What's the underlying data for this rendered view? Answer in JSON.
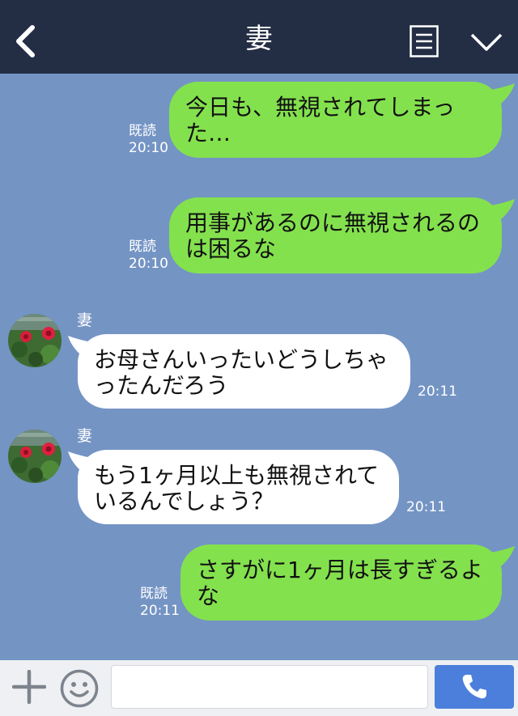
{
  "header": {
    "title": "妻",
    "icons": [
      "chevron-left-icon",
      "notes-icon",
      "chevron-down-icon"
    ],
    "background": "#232e45"
  },
  "chat": {
    "background": "#7494c4",
    "outgoing_bubble_color": "#84e14e",
    "incoming_bubble_color": "#ffffff",
    "messages": [
      {
        "direction": "out",
        "text": "今日も、無視されてしまった…",
        "read_label": "既読",
        "time": "20:10"
      },
      {
        "direction": "out",
        "text": "用事があるのに無視されるのは困るな",
        "read_label": "既読",
        "time": "20:10"
      },
      {
        "direction": "in",
        "sender": "妻",
        "text": "お母さんいったいどうしちゃったんだろう",
        "time": "20:11"
      },
      {
        "direction": "in",
        "sender": "妻",
        "text": "もう1ヶ月以上も無視されているんでしょう？",
        "time": "20:11"
      },
      {
        "direction": "out",
        "text": "さすがに1ヶ月は長すぎるよな",
        "read_label": "既読",
        "time": "20:11"
      }
    ]
  },
  "footer": {
    "input_value": "",
    "input_placeholder": "",
    "icons": [
      "plus-icon",
      "emoji-icon",
      "phone-icon"
    ],
    "send_button_color": "#4b7fdb"
  }
}
